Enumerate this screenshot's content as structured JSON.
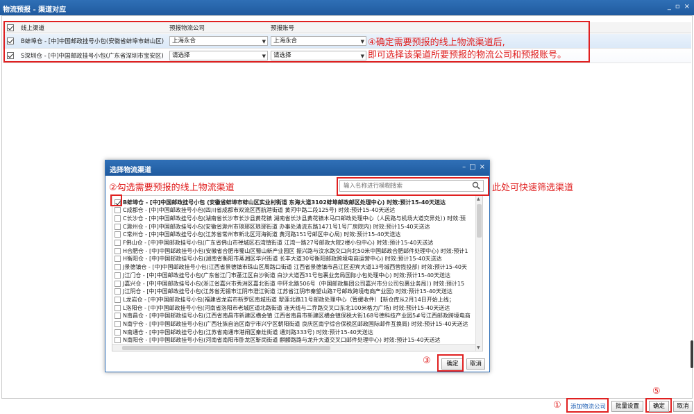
{
  "window": {
    "title": "物流预报 - 渠道对应",
    "controls": [
      "_",
      "▫",
      "×"
    ]
  },
  "grid": {
    "headers": {
      "channel": "线上渠道",
      "logistics_company": "预报物流公司",
      "account": "预报账号"
    },
    "rows": [
      {
        "channel": "B蚌埠仓 - [中]中国邮政挂号小包(安徽省蚌埠市蚌山区)",
        "logistics_company": "上海永合",
        "account": "上海永合"
      },
      {
        "channel": "S深圳仓 - [中]中国邮政挂号小包(广东省深圳市宝安区)",
        "logistics_company": "请选择",
        "account": "请选择"
      }
    ]
  },
  "annotations": {
    "a4_line1": "④确定需要预报的线上物流渠道后,",
    "a4_line2": "即可选择该渠道所要预报的物流公司和预报账号。",
    "a2": "②勾选需要预报的线上物流渠道",
    "search_hint": "此处可快速筛选渠道",
    "n1": "①",
    "n3": "③",
    "n5": "⑤"
  },
  "dialog": {
    "title": "选择物流渠道",
    "controls": [
      "–",
      "□",
      "×"
    ],
    "search_placeholder": "输入名称进行模糊搜索",
    "items": [
      {
        "text": "B蚌埠仓 - [中]中国邮政挂号小包 (安徽省蚌埠市蚌山区实业村街道 东海大道3102蚌埠邮政邮区处理中心) 时效:预计15-40天送达",
        "checked": true
      },
      {
        "text": "C成都仓 - [中]中国邮政挂号小包(四川省成都市双流区西航港街道 黄河中路二段125号) 时效:预计15-40天送达",
        "checked": false
      },
      {
        "text": "C长沙仓 - [中]中国邮政挂号小包(湖南省长沙市长沙县黄花镇 湖南省长沙县黄花镇木马口邮政处理中心（人民路与机场大道交界处）) 时效:预",
        "checked": false
      },
      {
        "text": "C滁州仓 - [中]中国邮政挂号小包(安徽省滁州市琅琊区琅琊街道 办事处清流东路1471号1号厂房院内) 时效:预计15-40天送达",
        "checked": false
      },
      {
        "text": "C常州仓 - [中]中国邮政挂号小包(江苏省常州市新北区河海街道 黄河路151号邮区中心局) 时效:预计15-40天送达",
        "checked": false
      },
      {
        "text": "F佛山仓 - [中]中国邮政挂号小包(广东省佛山市禅城区石湾镇街道 江湾一路27号邮政大院2楼小包中心) 时效:预计15-40天送达",
        "checked": false
      },
      {
        "text": "H合肥仓 - [中]中国邮政挂号小包(安徽省合肥市蜀山区蜀山新产业园区 振兴路与汶水路交口向北50米中国邮政合肥邮件处理中心) 时效:预计1",
        "checked": false
      },
      {
        "text": "H衡阳仓 - [中]中国邮政挂号小包(湖南省衡阳市蒸湘区华兴街道 长丰大道30号衡阳邮政跨境电商运营中心) 时效:预计15-40天送达",
        "checked": false
      },
      {
        "text": "J景德镇仓 - [中]中国邮政挂号小包(江西省景德镇市珠山区周路口街道 江西省景德镇市昌江区迎宾大道13号城西营揽投部) 时效:预计15-40天",
        "checked": false
      },
      {
        "text": "J江门仓 - [中]中国邮政挂号小包(广东省江门市蓬江区白沙街道 白沙大道西31号包裹业务局国际小包处理中心) 时效:预计15-40天送达",
        "checked": false
      },
      {
        "text": "J嘉兴仓 - [中]中国邮政挂号小包(浙江省嘉兴市秀洲区嘉北街道 中环北路506号（中国邮政集团公司嘉兴市分公司包裹业务局）) 时效:预计15",
        "checked": false
      },
      {
        "text": "J江阴仓 - [中]中国邮政挂号小包(江苏省无锡市江阴市澄江街道 江苏省江阴市秦望山路7号邮政跨境电商产业园) 时效:预计15-40天送达",
        "checked": false
      },
      {
        "text": "L龙岩仓 - [中]中国邮政挂号小包(福建省龙岩市新罗区南城街道 翠莲北路11号邮政处理中心（暂缓收件）【新仓库从2月14日开始上线；",
        "checked": false
      },
      {
        "text": "L洛阳仓 - [中]中国邮政挂号小包(河南省洛阳市老城区道北路街道 连天线与二乔路交叉口东北100米格力广场) 时效:预计15-40天送达",
        "checked": false
      },
      {
        "text": "N南昌仓 - [中]中国邮政挂号小包(江西省南昌市新建区横会镇 江西省南昌市新建区横会镇保税大街168号德科技产业园5#号江西邮政跨境电商",
        "checked": false
      },
      {
        "text": "N南宁仓 - [中]中国邮政挂号小包(广西壮族自治区南宁市兴宁区朝阳街道 良庆区南宁综合保税区邮政国际邮件互换局) 时效:预计15-40天送达",
        "checked": false
      },
      {
        "text": "N南通仓 - [中]中国邮政挂号小包(江苏省南通市港闸区秦灶街道 通刘路333号) 时效:预计15-40天送达",
        "checked": false
      },
      {
        "text": "N南阳仓 - [中]中国邮政挂号小包(河南省南阳市卧龙区靳岗街道 麒麟路路与龙升大道交叉口邮件处理中心) 时效:预计15-40天送达",
        "checked": false
      },
      {
        "text": "P莆田仓 - [中]中国邮政挂号小包(福建省莆田市荔城区西天尾镇 福建省莆田市荔城区黄石镇双霞路中邮车汇快递处理中心（特运组理部）时效",
        "checked": false
      }
    ],
    "ok_label": "确定",
    "cancel_label": "取消"
  },
  "bottom": {
    "add_company": "添加物流公司",
    "batch_settings": "批量设置",
    "ok": "确定",
    "cancel": "取消"
  },
  "colors": {
    "title_bar": "#2f6fb6",
    "annotation": "#e02020",
    "link": "#1f5fb4"
  }
}
